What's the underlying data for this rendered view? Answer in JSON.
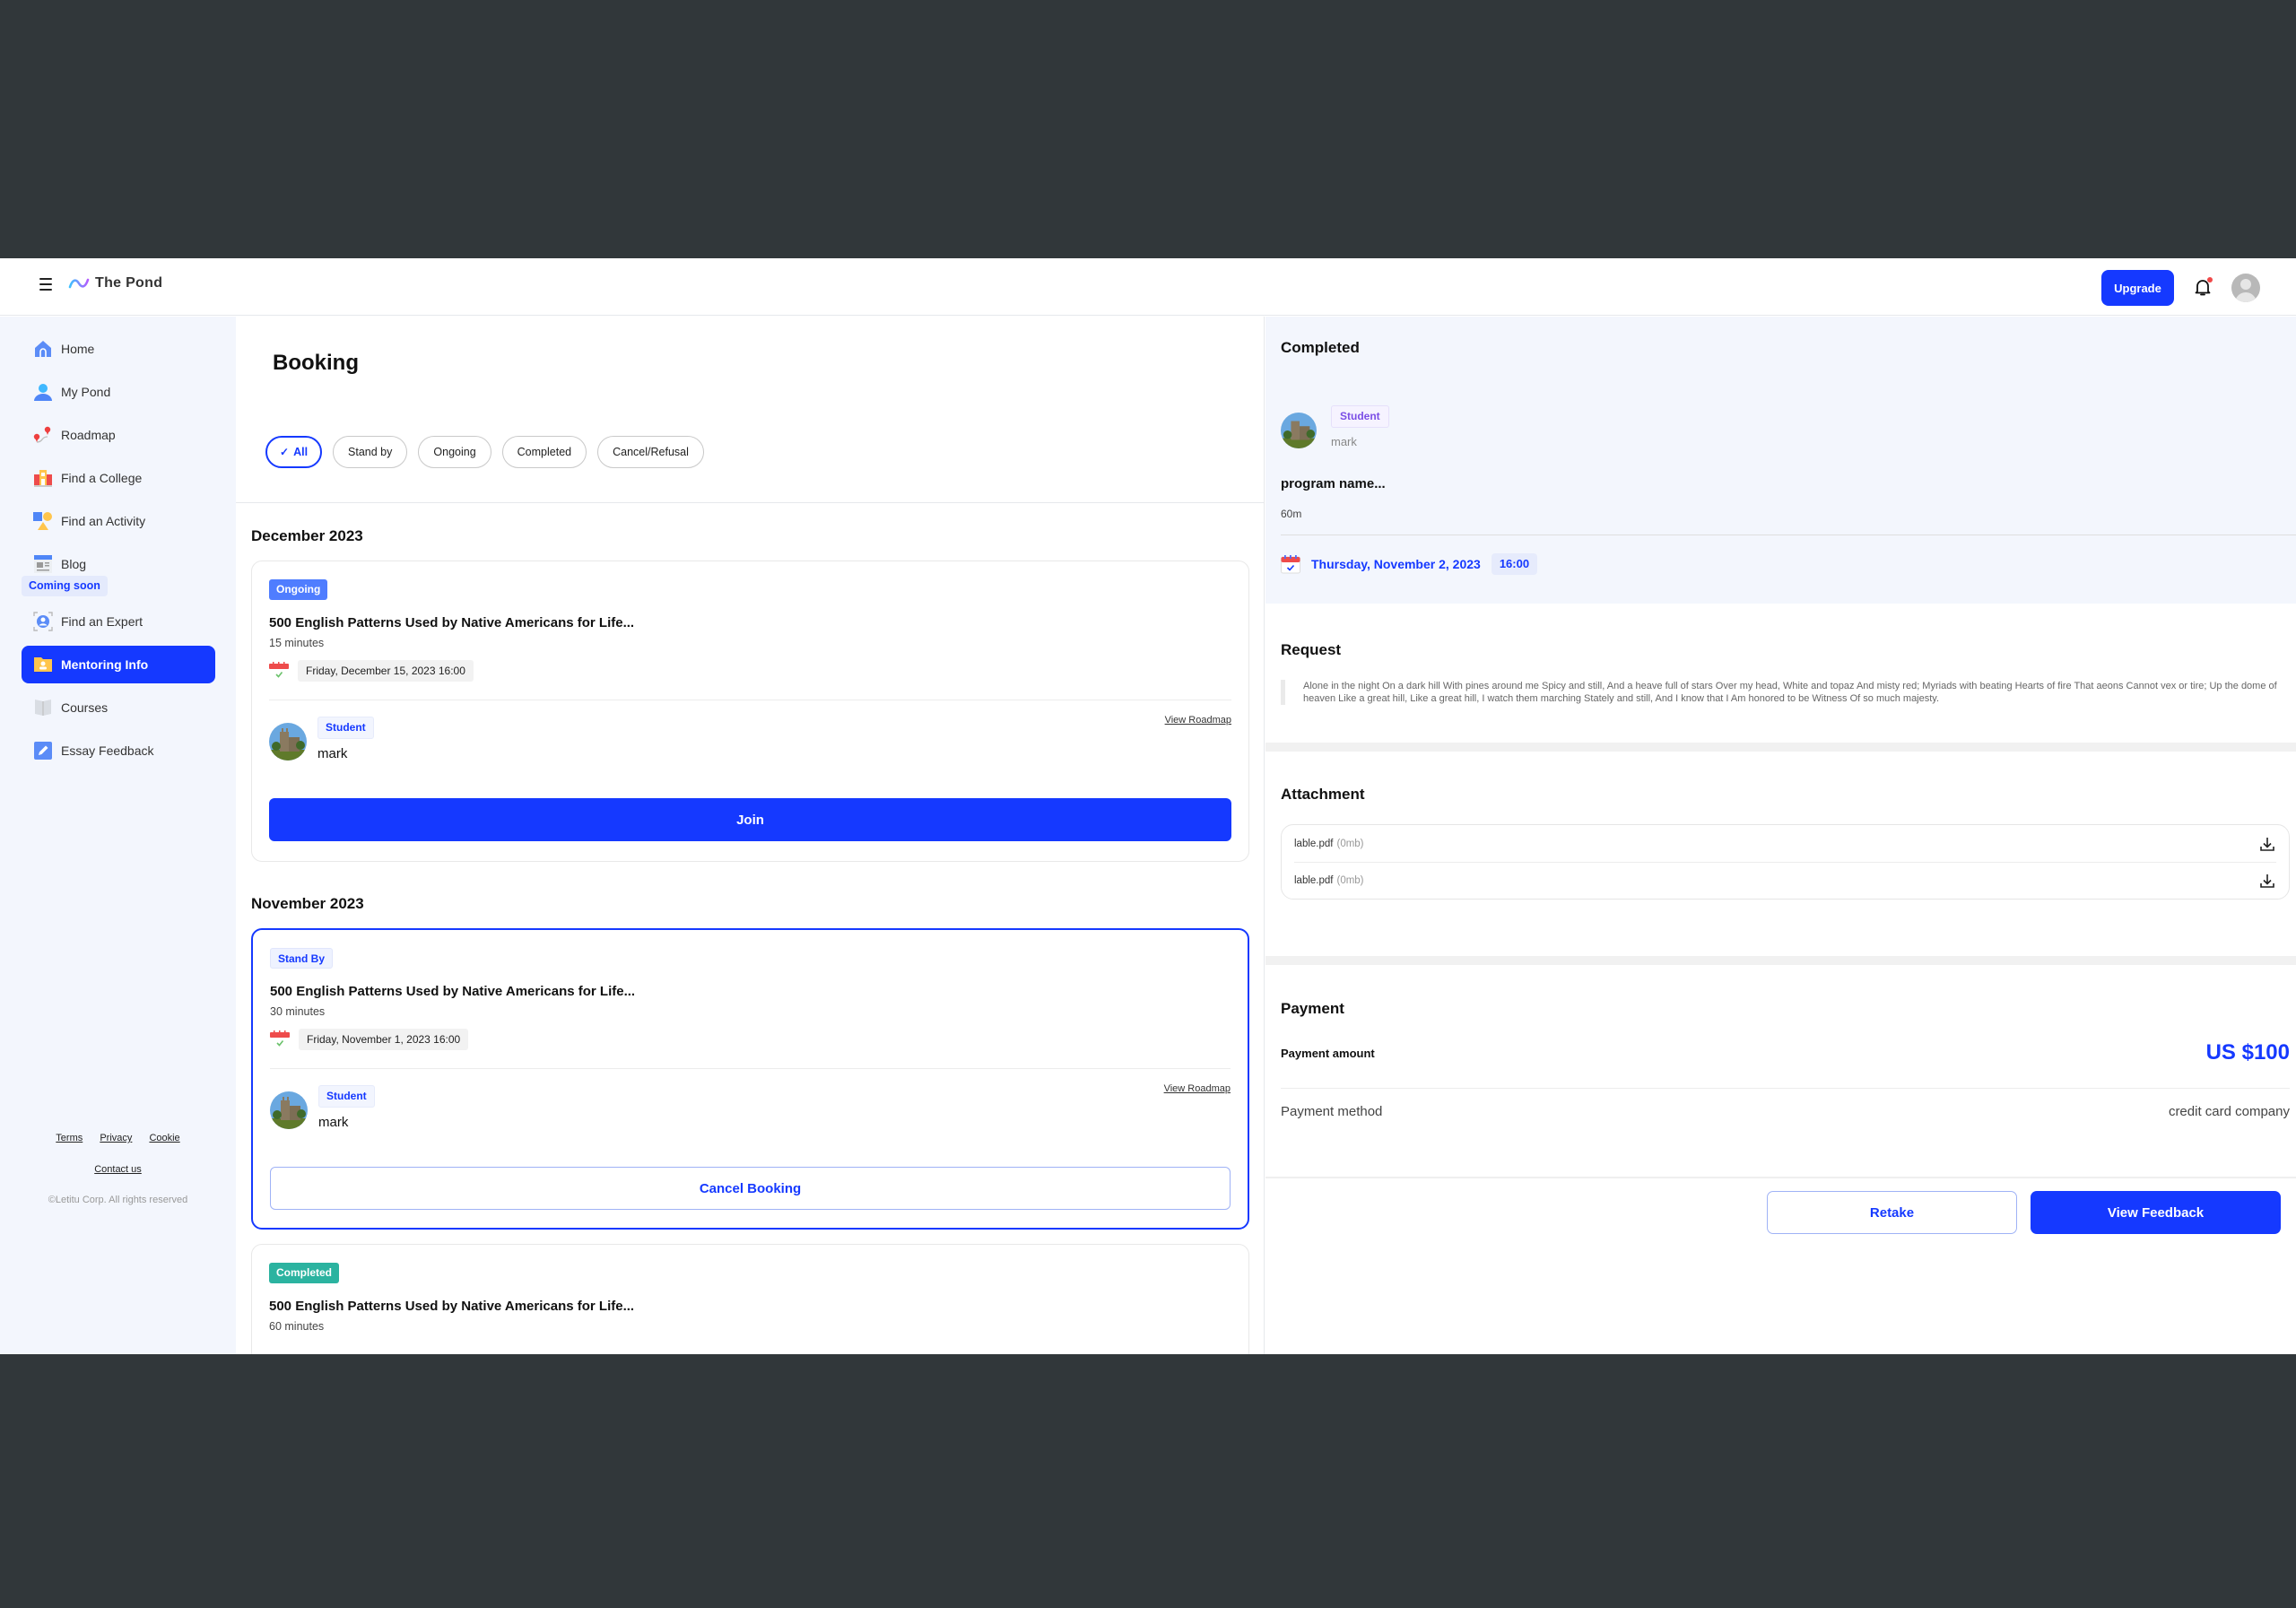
{
  "header": {
    "app_name": "The Pond",
    "upgrade_label": "Upgrade",
    "notification_dot": true
  },
  "sidebar": {
    "items": [
      {
        "label": "Home",
        "icon": "home-icon"
      },
      {
        "label": "My Pond",
        "icon": "person-icon"
      },
      {
        "label": "Roadmap",
        "icon": "roadmap-pins-icon"
      },
      {
        "label": "Find a College",
        "icon": "college-building-icon"
      },
      {
        "label": "Find an Activity",
        "icon": "shapes-icon"
      },
      {
        "label": "Blog",
        "icon": "blog-icon"
      }
    ],
    "coming_soon_label": "Coming soon",
    "soon_items": [
      {
        "label": "Find an Expert",
        "icon": "expert-icon"
      },
      {
        "label": "Mentoring Info",
        "icon": "folder-user-icon",
        "active": true
      },
      {
        "label": "Courses",
        "icon": "book-icon"
      },
      {
        "label": "Essay Feedback",
        "icon": "pencil-icon"
      }
    ],
    "footer": {
      "terms": "Terms",
      "privacy": "Privacy",
      "cookie": "Cookie",
      "contact": "Contact us",
      "copyright": "©Letitu Corp. All rights reserved"
    }
  },
  "main": {
    "title": "Booking",
    "filters": [
      {
        "label": "All",
        "active": true
      },
      {
        "label": "Stand by"
      },
      {
        "label": "Ongoing"
      },
      {
        "label": "Completed"
      },
      {
        "label": "Cancel/Refusal"
      }
    ],
    "groups": [
      {
        "month": "December 2023",
        "bookings": [
          {
            "status": "Ongoing",
            "title": "500 English Patterns Used by Native Americans for Life...",
            "duration": "15 minutes",
            "datetime": "Friday, December 15, 2023 16:00",
            "role": "Student",
            "name": "mark",
            "link": "View Roadmap",
            "action": "Join"
          }
        ]
      },
      {
        "month": "November 2023",
        "bookings": [
          {
            "status": "Stand By",
            "title": "500 English Patterns Used by Native Americans for Life...",
            "duration": "30 minutes",
            "datetime": "Friday, November 1, 2023 16:00",
            "role": "Student",
            "name": "mark",
            "link": "View Roadmap",
            "action": "Cancel Booking",
            "selected": true
          },
          {
            "status": "Completed",
            "title": "500 English Patterns Used by Native Americans for Life...",
            "duration": "60 minutes"
          }
        ]
      }
    ]
  },
  "detail": {
    "status": "Completed",
    "role": "Student",
    "name": "mark",
    "program": "program name...",
    "duration": "60m",
    "date": "Thursday, November 2, 2023",
    "time": "16:00",
    "request_title": "Request",
    "request_text": "Alone in the night On a dark hill With pines around me Spicy and still, And a heave full of stars Over my head, White and topaz And misty red; Myriads with beating Hearts of fire That aeons Cannot vex or tire; Up the dome of heaven Like a great hill, Like a great hill, I watch them marching Stately and still, And I know that I Am honored to be Witness Of so much majesty.",
    "attachment_title": "Attachment",
    "attachments": [
      {
        "name": "lable.pdf",
        "size": "(0mb)"
      },
      {
        "name": "lable.pdf",
        "size": "(0mb)"
      }
    ],
    "payment_title": "Payment",
    "payment_amount_label": "Payment amount",
    "payment_amount": "US $100",
    "payment_method_label": "Payment method",
    "payment_method": "credit card company",
    "retake_label": "Retake",
    "view_feedback_label": "View Feedback"
  },
  "colors": {
    "brand": "#1539ff",
    "ongoing": "#4f7dff",
    "completed": "#2bb3a0",
    "sidebar_bg": "#f3f6fd",
    "notification": "#f04848"
  }
}
